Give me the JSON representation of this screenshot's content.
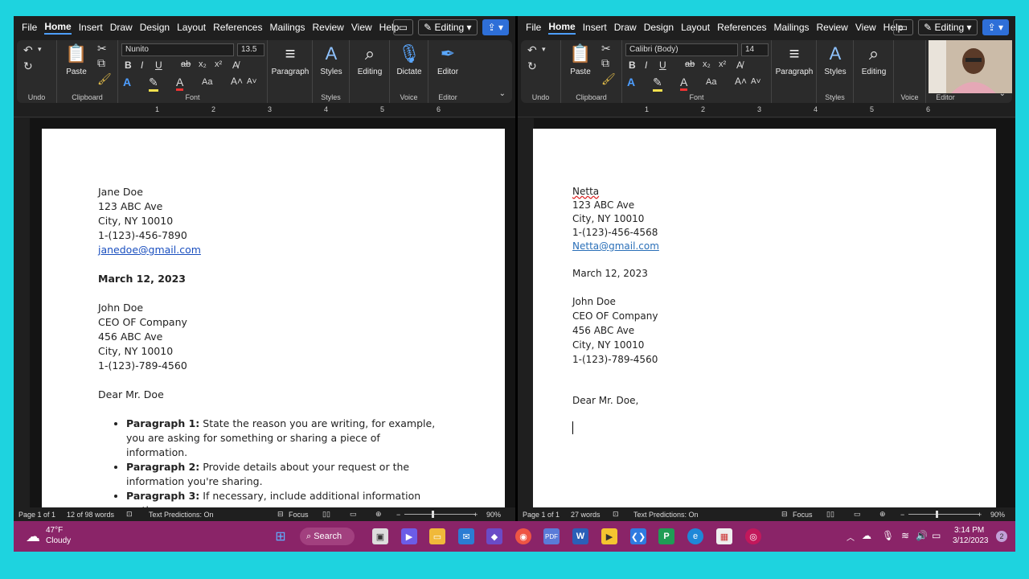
{
  "left_window": {
    "menu": [
      "File",
      "Home",
      "Insert",
      "Draw",
      "Design",
      "Layout",
      "References",
      "Mailings",
      "Review",
      "View",
      "Help"
    ],
    "active_menu": "Home",
    "editing_label": "Editing",
    "ribbon": {
      "undo_label": "Undo",
      "clipboard_label": "Clipboard",
      "paste_label": "Paste",
      "font_name": "Nunito",
      "font_size": "13.5",
      "font_label": "Font",
      "paragraph_label": "Paragraph",
      "styles_label": "Styles",
      "styles_group_label": "Styles",
      "editing_label": "Editing",
      "dictate_label": "Dictate",
      "voice_label": "Voice",
      "editor_label": "Editor",
      "editor_group_label": "Editor"
    },
    "document": {
      "sender_name": "Jane Doe",
      "sender_street": "123 ABC Ave",
      "sender_city": "City, NY  10010",
      "sender_phone": "1-(123)-456-7890",
      "sender_email": "janedoe@gmail.com",
      "date": "March 12, 2023",
      "recipient_name": "John Doe",
      "recipient_title": "CEO OF Company",
      "recipient_street": "456 ABC Ave",
      "recipient_city": "City, NY  10010",
      "recipient_phone": "1-(123)-789-4560",
      "salutation": "Dear Mr. Doe",
      "paragraphs": [
        {
          "head": "Paragraph 1:",
          "text": " State the reason you are writing, for example, you are asking for something or sharing a piece of information."
        },
        {
          "head": "Paragraph 2:",
          "text": " Provide details about your request or the information you're sharing."
        },
        {
          "head": "Paragraph 3:",
          "text": " If necessary, include additional information on the"
        }
      ]
    },
    "status": {
      "page": "Page 1 of 1",
      "words": "12 of 98 words",
      "predictions": "Text Predictions: On",
      "focus": "Focus",
      "zoom": "90%"
    }
  },
  "right_window": {
    "menu": [
      "File",
      "Home",
      "Insert",
      "Draw",
      "Design",
      "Layout",
      "References",
      "Mailings",
      "Review",
      "View",
      "Help"
    ],
    "active_menu": "Home",
    "editing_label": "Editing",
    "ribbon": {
      "undo_label": "Undo",
      "clipboard_label": "Clipboard",
      "paste_label": "Paste",
      "font_name": "Calibri (Body)",
      "font_size": "14",
      "font_label": "Font",
      "paragraph_label": "Paragraph",
      "styles_label": "Styles",
      "styles_group_label": "Styles",
      "editing_label": "Editing",
      "voice_label": "Voice",
      "editor_group_label": "Editor"
    },
    "document": {
      "sender_name": "Netta",
      "sender_street": "123 ABC Ave",
      "sender_city": "City, NY  10010",
      "sender_phone": "1-(123)-456-4568",
      "sender_email": "Netta@gmail.com",
      "date": "March 12, 2023",
      "recipient_name": "John Doe",
      "recipient_title": "CEO OF Company",
      "recipient_street": "456 ABC Ave",
      "recipient_city": "City, NY  10010",
      "recipient_phone": "1-(123)-789-4560",
      "salutation": "Dear Mr. Doe,"
    },
    "status": {
      "page": "Page 1 of 1",
      "words": "27 words",
      "predictions": "Text Predictions: On",
      "focus": "Focus",
      "zoom": "90%"
    }
  },
  "ruler_numbers": [
    "1",
    "2",
    "3",
    "4",
    "5",
    "6"
  ],
  "taskbar": {
    "weather_temp": "47°F",
    "weather_desc": "Cloudy",
    "search_label": "Search",
    "time": "3:14 PM",
    "date": "3/12/2023",
    "notification_count": "2"
  },
  "colors": {
    "accent": "#2e6fd8",
    "taskbar": "#8a2468",
    "frame": "#1ed3df"
  }
}
